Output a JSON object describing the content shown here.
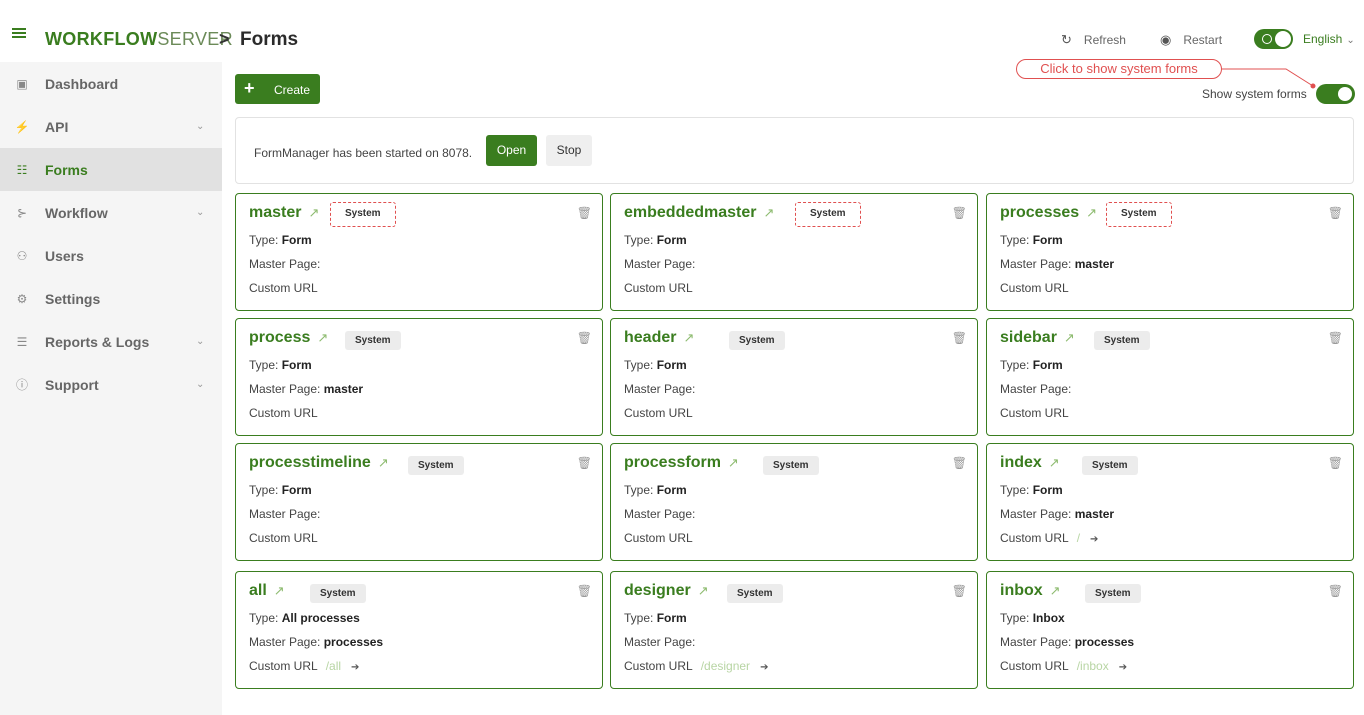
{
  "header": {
    "logo_bold": "WORKFLOW",
    "logo_light": "SERVER",
    "separator": ">",
    "title": "Forms",
    "refresh_label": "Refresh",
    "restart_label": "Restart",
    "language": "English"
  },
  "sidebar": {
    "items": [
      {
        "label": "Dashboard",
        "icon": "dashboard-icon"
      },
      {
        "label": "API",
        "icon": "plug-icon",
        "has_chevron": true
      },
      {
        "label": "Forms",
        "icon": "form-icon",
        "active": true
      },
      {
        "label": "Workflow",
        "icon": "workflow-icon",
        "has_chevron": true
      },
      {
        "label": "Users",
        "icon": "users-icon"
      },
      {
        "label": "Settings",
        "icon": "gears-icon"
      },
      {
        "label": "Reports & Logs",
        "icon": "reports-icon",
        "has_chevron": true
      },
      {
        "label": "Support",
        "icon": "help-icon",
        "has_chevron": true
      }
    ]
  },
  "toolbar": {
    "create_label": "Create",
    "hint": "Click to show system forms",
    "show_system_label": "Show system forms",
    "show_system_on": true
  },
  "form_manager": {
    "message": "FormManager has been started on 8078.",
    "open_label": "Open",
    "stop_label": "Stop"
  },
  "labels": {
    "type": "Type:",
    "master_page": "Master Page:",
    "custom_url": "Custom URL"
  },
  "cards": [
    {
      "name": "master",
      "badge": "System",
      "type": "Form",
      "master_page": "",
      "custom_url": ""
    },
    {
      "name": "embeddedmaster",
      "badge": "System",
      "type": "Form",
      "master_page": "",
      "custom_url": ""
    },
    {
      "name": "processes",
      "badge": "System",
      "type": "Form",
      "master_page": "master",
      "custom_url": ""
    },
    {
      "name": "process",
      "badge": "System",
      "type": "Form",
      "master_page": "master",
      "custom_url": ""
    },
    {
      "name": "header",
      "badge": "System",
      "type": "Form",
      "master_page": "",
      "custom_url": ""
    },
    {
      "name": "sidebar",
      "badge": "System",
      "type": "Form",
      "master_page": "",
      "custom_url": ""
    },
    {
      "name": "processtimeline",
      "badge": "System",
      "type": "Form",
      "master_page": "",
      "custom_url": ""
    },
    {
      "name": "processform",
      "badge": "System",
      "type": "Form",
      "master_page": "",
      "custom_url": ""
    },
    {
      "name": "index",
      "badge": "System",
      "type": "Form",
      "master_page": "master",
      "custom_url": "/"
    },
    {
      "name": "all",
      "badge": "System",
      "type": "All processes",
      "master_page": "processes",
      "custom_url": "/all"
    },
    {
      "name": "designer",
      "badge": "System",
      "type": "Form",
      "master_page": "",
      "custom_url": "/designer"
    },
    {
      "name": "inbox",
      "badge": "System",
      "type": "Inbox",
      "master_page": "processes",
      "custom_url": "/inbox"
    }
  ],
  "colors": {
    "accent": "#3a7d1f",
    "hint_red": "#e05050"
  }
}
